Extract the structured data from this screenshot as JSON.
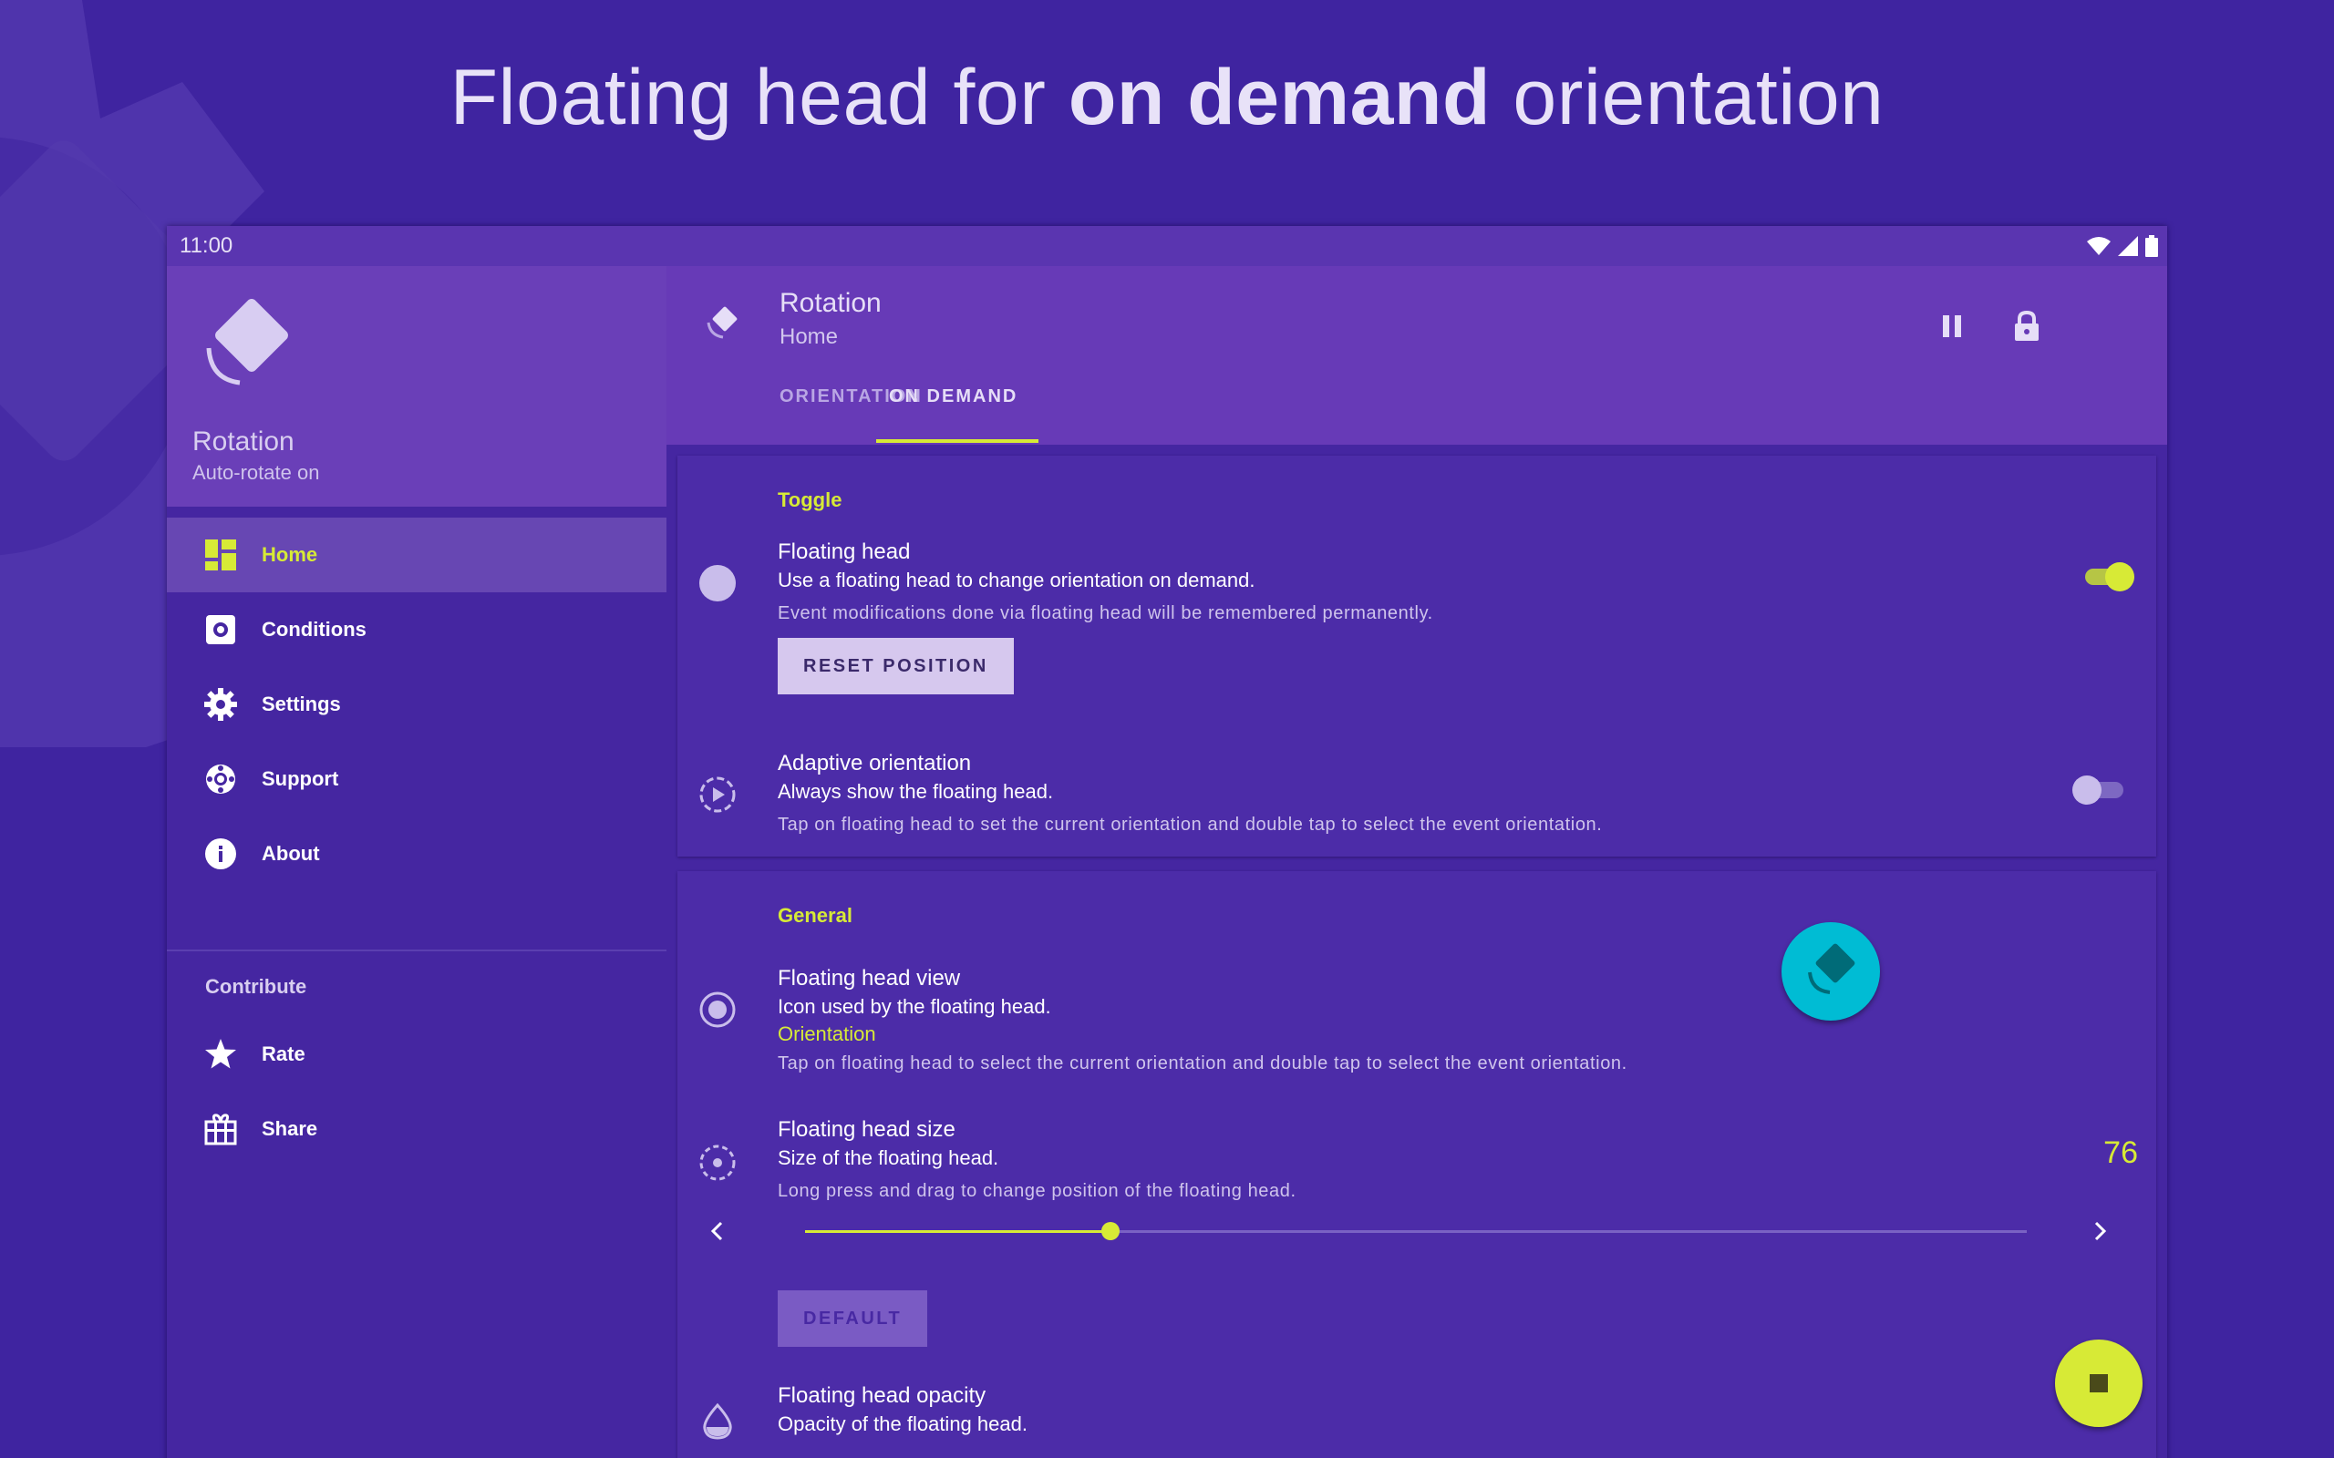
{
  "headline": {
    "before": "Floating head for ",
    "bold": "on demand",
    "after": " orientation"
  },
  "statusbar": {
    "time": "11:00"
  },
  "drawer": {
    "title": "Rotation",
    "subtitle": "Auto-rotate on",
    "items": [
      {
        "label": "Home",
        "icon": "dashboard-icon",
        "active": true
      },
      {
        "label": "Conditions",
        "icon": "conditions-icon"
      },
      {
        "label": "Settings",
        "icon": "gear-icon"
      },
      {
        "label": "Support",
        "icon": "lifebuoy-icon"
      },
      {
        "label": "About",
        "icon": "info-icon"
      }
    ],
    "contribute_label": "Contribute",
    "contribute_items": [
      {
        "label": "Rate",
        "icon": "star-icon"
      },
      {
        "label": "Share",
        "icon": "gift-icon"
      }
    ]
  },
  "toolbar": {
    "title": "Rotation",
    "subtitle": "Home",
    "tabs": [
      "ORIENTATION",
      "ON DEMAND"
    ],
    "active_tab": 1
  },
  "toggle_section": {
    "title": "Toggle",
    "floating_head": {
      "title": "Floating head",
      "summary": "Use a floating head to change orientation on demand.",
      "note": "Event modifications done via floating head will be remembered permanently.",
      "enabled": true,
      "button": "RESET POSITION"
    },
    "adaptive": {
      "title": "Adaptive orientation",
      "summary": "Always show the floating head.",
      "note": "Tap on floating head to set the current orientation and double tap to select the event orientation.",
      "enabled": false
    }
  },
  "general_section": {
    "title": "General",
    "view": {
      "title": "Floating head view",
      "summary": "Icon used by the floating head.",
      "value": "Orientation",
      "note": "Tap on floating head to select the current orientation and double tap to select the event orientation."
    },
    "size": {
      "title": "Floating head size",
      "summary": "Size of the floating head.",
      "note": "Long press and drag to change position of the floating head.",
      "value": "76",
      "slider_fraction": 0.25,
      "button": "DEFAULT"
    },
    "opacity": {
      "title": "Floating head opacity",
      "summary": "Opacity of the floating head."
    }
  },
  "colors": {
    "accent": "#d7ea36",
    "primary": "#673ab7",
    "background": "#3f24a0",
    "floating_head": "#00bcd4"
  }
}
